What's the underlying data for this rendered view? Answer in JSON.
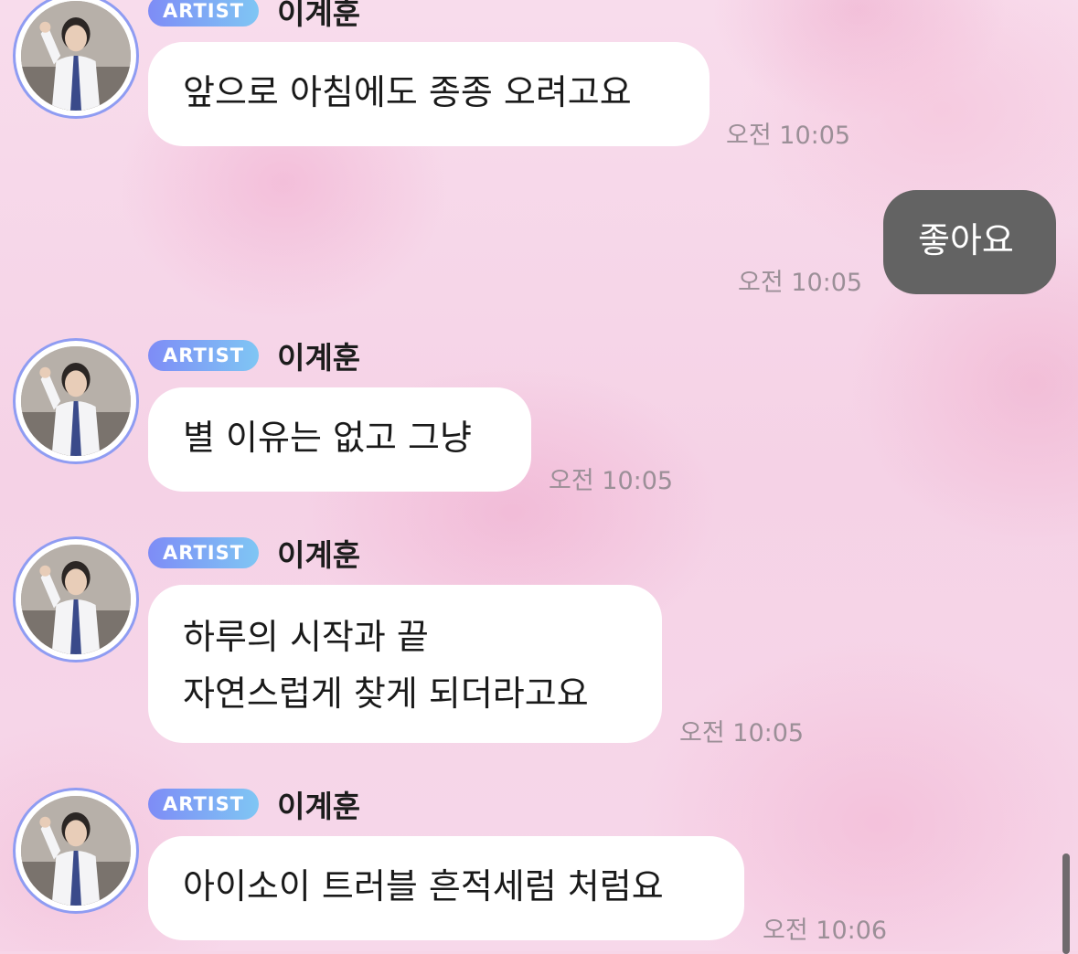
{
  "messages": [
    {
      "badge": "ARTIST",
      "sender": "이계훈",
      "lines": [
        "앞으로 아침에도 종종 오려고요"
      ],
      "time": "오전 10:05"
    },
    {
      "self": true,
      "lines": [
        "좋아요"
      ],
      "time": "오전 10:05"
    },
    {
      "badge": "ARTIST",
      "sender": "이계훈",
      "lines": [
        "별 이유는 없고 그냥"
      ],
      "time": "오전 10:05"
    },
    {
      "badge": "ARTIST",
      "sender": "이계훈",
      "lines": [
        "하루의 시작과 끝",
        "자연스럽게 찾게 되더라고요"
      ],
      "time": "오전 10:05"
    },
    {
      "badge": "ARTIST",
      "sender": "이계훈",
      "lines": [
        "아이소이 트러블 흔적세럼 처럼요"
      ],
      "time": "오전 10:06"
    }
  ],
  "colors": {
    "badge_gradient_start": "#7e8cf6",
    "badge_gradient_end": "#7fc6f4",
    "self_bubble": "#636363",
    "other_bubble": "#ffffff",
    "background": "#f7d6e8",
    "avatar_ring": "#8f9cf2"
  },
  "icons": {
    "avatar": "artist-profile-photo"
  }
}
